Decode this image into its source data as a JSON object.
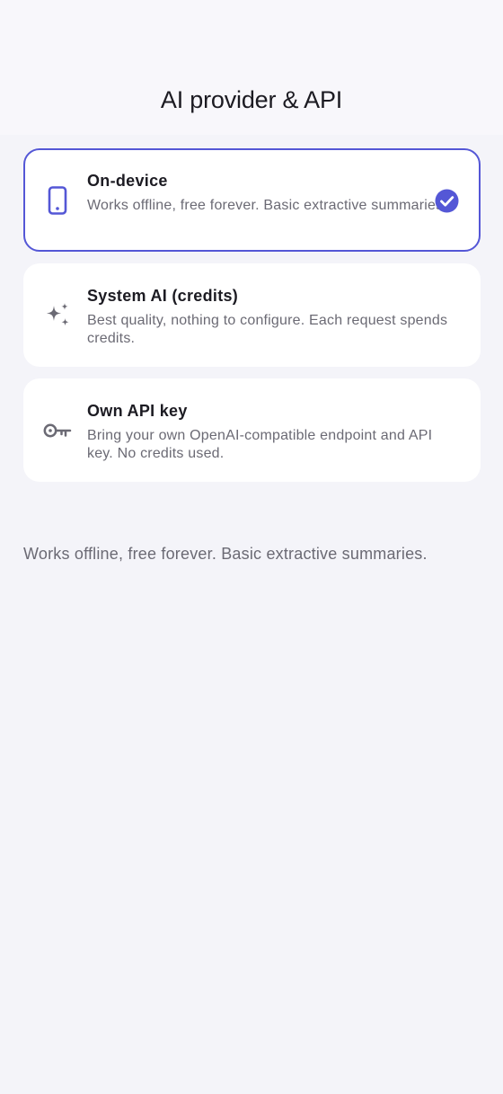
{
  "header": {
    "title": "AI provider & API"
  },
  "options": [
    {
      "title": "On-device",
      "description": "Works offline, free forever. Basic extractive summaries.",
      "icon": "phone-icon",
      "selected": true
    },
    {
      "title": "System AI (credits)",
      "description": "Best quality, nothing to configure. Each request spends credits.",
      "icon": "sparkles-icon",
      "selected": false
    },
    {
      "title": "Own API key",
      "description": "Bring your own OpenAI-compatible endpoint and API key. No credits used.",
      "icon": "key-icon",
      "selected": false
    }
  ],
  "footer": {
    "description": "Works offline, free forever. Basic extractive summaries."
  },
  "colors": {
    "accent": "#5457d6",
    "background": "#f4f4f9",
    "card": "#ffffff",
    "title_text": "#1c1b22",
    "secondary_text": "#6b6a74",
    "icon_gray": "#6b6a74"
  }
}
